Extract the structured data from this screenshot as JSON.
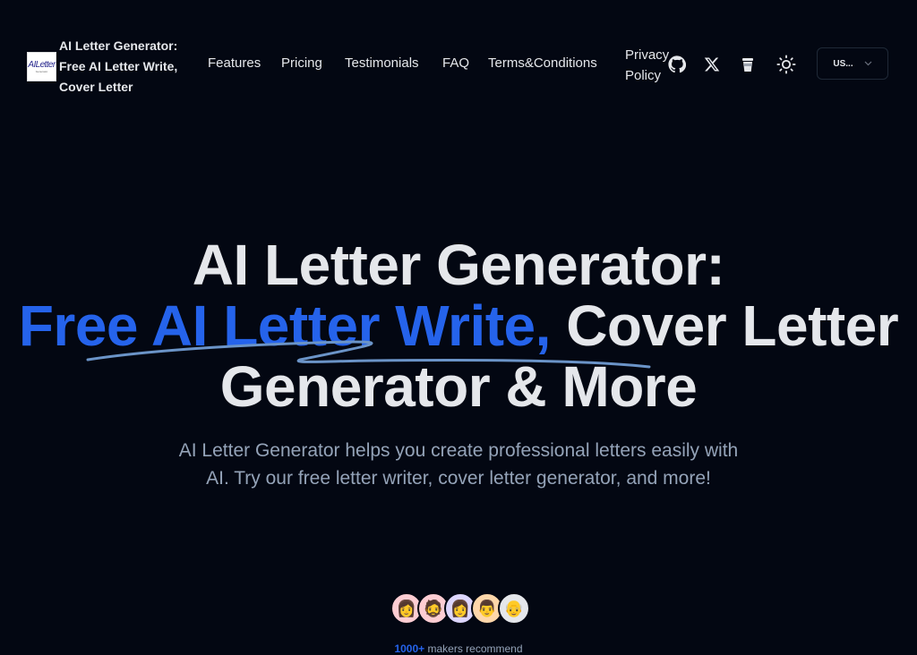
{
  "header": {
    "logo_text": "AILetter",
    "logo_subtext": "Generator",
    "brand_title": "AI Letter Generator: Free AI Letter Write, Cover Letter",
    "nav": [
      {
        "label": "Features"
      },
      {
        "label": "Pricing"
      },
      {
        "label": "Testimonials"
      },
      {
        "label": "FAQ"
      },
      {
        "label": "Terms&Conditions"
      },
      {
        "label": "Privacy Policy"
      }
    ],
    "icons": [
      "github-icon",
      "x-twitter-icon",
      "coffee-cup-icon",
      "theme-sun-icon"
    ],
    "language_select": {
      "value": "US...",
      "icon": "chevron-down-icon"
    }
  },
  "hero": {
    "title_line1": "AI Letter Generator:",
    "title_accent": "Free AI Letter Write,",
    "title_rest": " Cover Letter Generator & More",
    "subtitle": "AI Letter Generator helps you create professional letters easily with AI. Try our free letter writer, cover letter generator, and more!",
    "accent_color": "#2563eb"
  },
  "social_proof": {
    "avatars": [
      {
        "bg": "#fecdd3",
        "emoji": "👩"
      },
      {
        "bg": "#fecdd3",
        "emoji": "🧔"
      },
      {
        "bg": "#ddd6fe",
        "emoji": "👩"
      },
      {
        "bg": "#fed7aa",
        "emoji": "👨"
      },
      {
        "bg": "#e5e7eb",
        "emoji": "👴"
      }
    ],
    "count": "1000+",
    "text": " makers recommend"
  }
}
